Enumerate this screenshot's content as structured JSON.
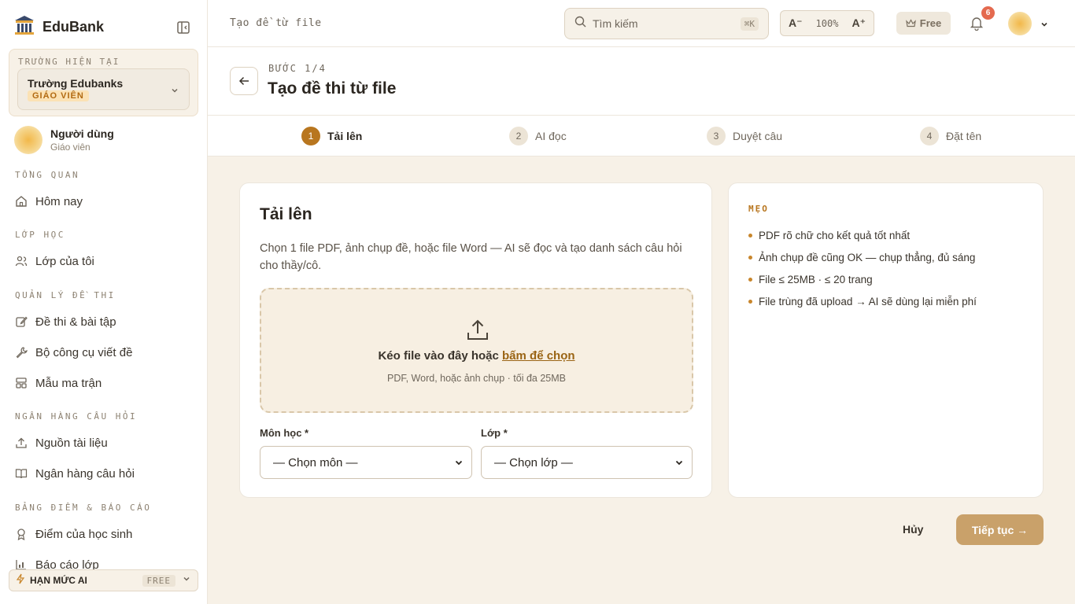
{
  "app": {
    "name": "EduBank"
  },
  "school": {
    "caption": "TRƯỜNG HIỆN TẠI",
    "name": "Trường Edubanks",
    "role": "GIÁO VIÊN"
  },
  "user": {
    "name": "Người dùng",
    "role": "Giáo viên"
  },
  "nav": {
    "sections": [
      {
        "title": "TỔNG QUAN",
        "items": [
          {
            "label": "Hôm nay",
            "icon": "home-icon"
          }
        ]
      },
      {
        "title": "LỚP HỌC",
        "items": [
          {
            "label": "Lớp của tôi",
            "icon": "users-icon"
          }
        ]
      },
      {
        "title": "QUẢN LÝ ĐỀ THI",
        "items": [
          {
            "label": "Đề thi & bài tập",
            "icon": "edit-icon"
          },
          {
            "label": "Bộ công cụ viết đề",
            "icon": "wrench-icon"
          },
          {
            "label": "Mẫu ma trận",
            "icon": "grid-icon"
          }
        ]
      },
      {
        "title": "NGÂN HÀNG CÂU HỎI",
        "items": [
          {
            "label": "Nguồn tài liệu",
            "icon": "upload-icon"
          },
          {
            "label": "Ngân hàng câu hỏi",
            "icon": "book-icon"
          }
        ]
      },
      {
        "title": "BẢNG ĐIỂM & BÁO CÁO",
        "items": [
          {
            "label": "Điểm của học sinh",
            "icon": "award-icon"
          },
          {
            "label": "Báo cáo lớp",
            "icon": "chart-icon"
          }
        ]
      }
    ]
  },
  "quota": {
    "label": "HẠN MỨC AI",
    "tier": "FREE"
  },
  "topbar": {
    "breadcrumb": "Tạo đề từ file",
    "search_placeholder": "Tìm kiếm",
    "search_shortcut": "⌘K",
    "zoom_minus": "A⁻",
    "zoom_value": "100%",
    "zoom_plus": "A⁺",
    "plan_label": "Free",
    "notification_count": "6"
  },
  "page": {
    "step_counter": "BƯỚC 1/4",
    "title": "Tạo đề thi từ file"
  },
  "steps": [
    {
      "num": "1",
      "label": "Tải lên",
      "active": true
    },
    {
      "num": "2",
      "label": "AI đọc",
      "active": false
    },
    {
      "num": "3",
      "label": "Duyệt câu",
      "active": false
    },
    {
      "num": "4",
      "label": "Đặt tên",
      "active": false
    }
  ],
  "upload": {
    "title": "Tải lên",
    "description": "Chọn 1 file PDF, ảnh chụp đề, hoặc file Word — AI sẽ đọc và tạo danh sách câu hỏi cho thầy/cô.",
    "drop_text": "Kéo file vào đây hoặc",
    "drop_link": "bấm để chọn",
    "drop_hint": "PDF, Word, hoặc ảnh chụp · tối đa 25MB",
    "subject_label": "Môn học *",
    "subject_value": "— Chọn môn —",
    "grade_label": "Lớp *",
    "grade_value": "— Chọn lớp —"
  },
  "tips": {
    "title": "MẸO",
    "items": [
      "PDF rõ chữ cho kết quả tốt nhất",
      "Ảnh chụp đề cũng OK — chụp thẳng, đủ sáng",
      "File ≤ 25MB · ≤ 20 trang",
      "File trùng đã upload → AI sẽ dùng lại miễn phí"
    ]
  },
  "actions": {
    "cancel": "Hủy",
    "next": "Tiếp tục →"
  },
  "colors": {
    "accent": "#b8761f",
    "background": "#f7f1e7",
    "primary_button": "#c9a16a",
    "badge": "#e46a4f"
  }
}
